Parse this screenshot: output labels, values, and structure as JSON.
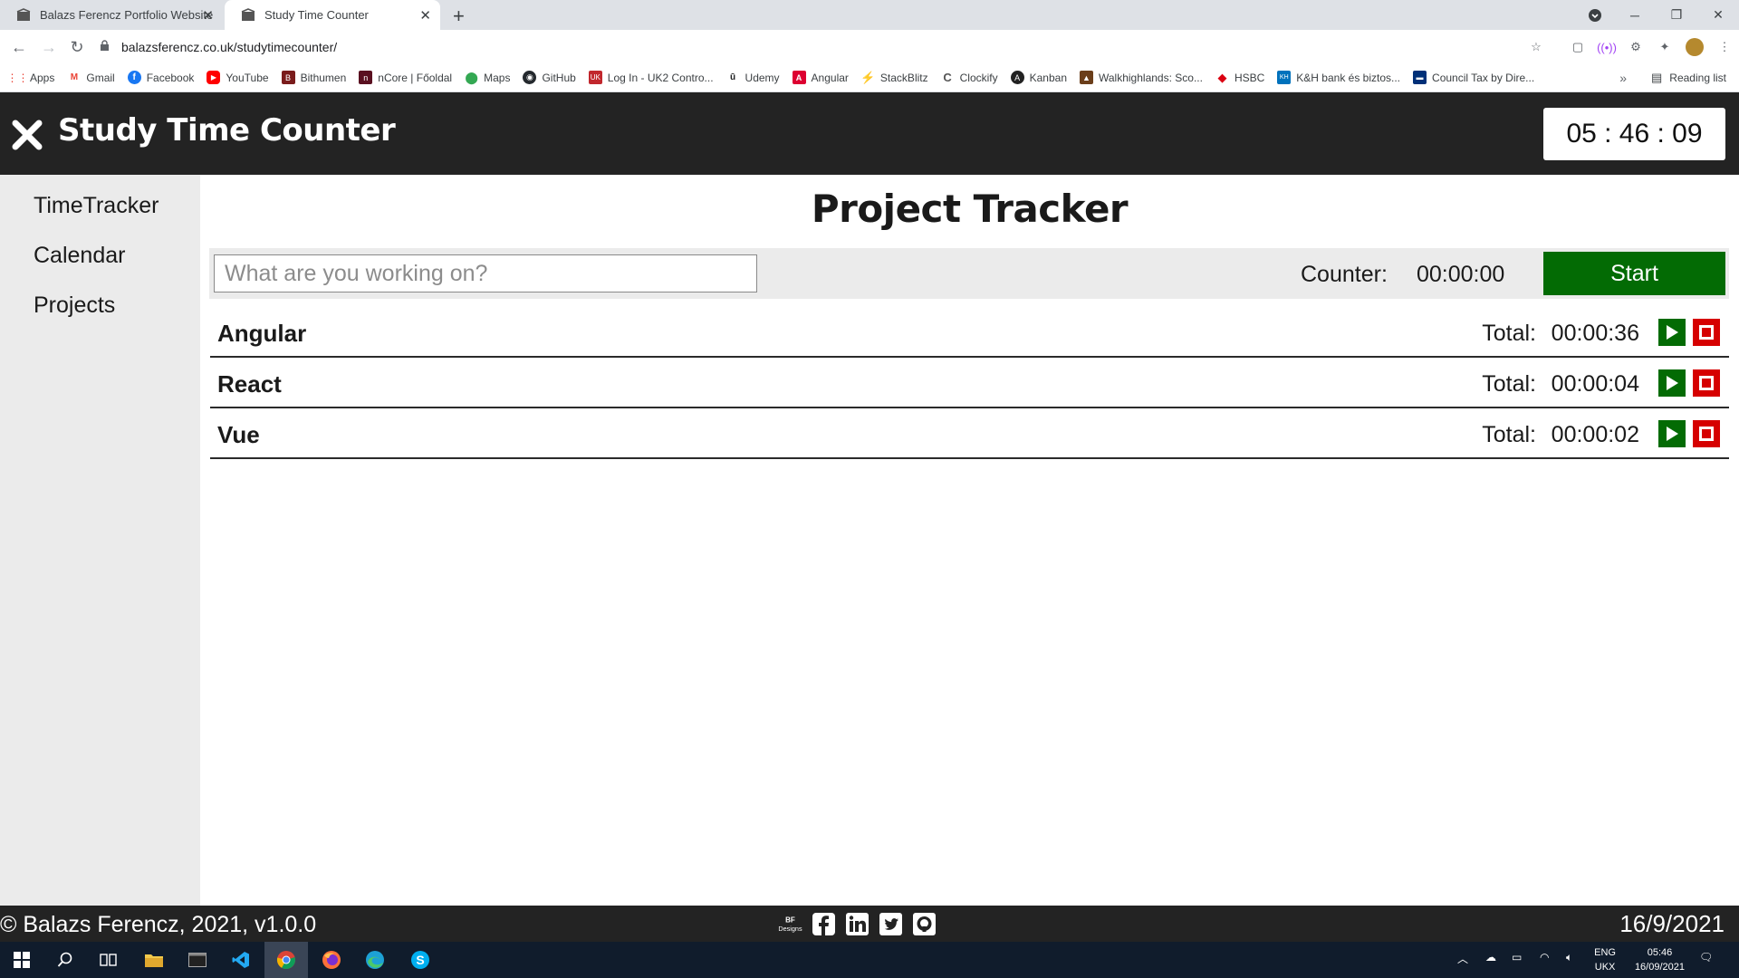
{
  "browser": {
    "tabs": [
      {
        "title": "Balazs Ferencz Portfolio Website"
      },
      {
        "title": "Study Time Counter"
      }
    ],
    "url": "balazsferencz.co.uk/studytimecounter/",
    "bookmarks": [
      {
        "label": "Apps",
        "icon": "apps-grid-icon",
        "color": "#ea4335"
      },
      {
        "label": "Gmail",
        "icon": "gmail-icon",
        "color": "#ea4335"
      },
      {
        "label": "Facebook",
        "icon": "facebook-icon",
        "color": "#1877f2"
      },
      {
        "label": "YouTube",
        "icon": "youtube-icon",
        "color": "#ff0000"
      },
      {
        "label": "Bithumen",
        "icon": "bithumen-icon",
        "color": "#7a1c1c"
      },
      {
        "label": "nCore | Főoldal",
        "icon": "ncore-icon",
        "color": "#5a1020"
      },
      {
        "label": "Maps",
        "icon": "maps-icon",
        "color": "#34a853"
      },
      {
        "label": "GitHub",
        "icon": "github-icon",
        "color": "#24292e"
      },
      {
        "label": "Log In - UK2 Contro...",
        "icon": "uk2-icon",
        "color": "#c1272d"
      },
      {
        "label": "Udemy",
        "icon": "udemy-icon",
        "color": "#1c1d1f"
      },
      {
        "label": "Angular",
        "icon": "angular-icon",
        "color": "#dd0031"
      },
      {
        "label": "StackBlitz",
        "icon": "stackblitz-icon",
        "color": "#1389fd"
      },
      {
        "label": "Clockify",
        "icon": "clockify-icon",
        "color": "#03a9f4"
      },
      {
        "label": "Kanban",
        "icon": "kanban-icon",
        "color": "#222222"
      },
      {
        "label": "Walkhighlands: Sco...",
        "icon": "walkhighlands-icon",
        "color": "#6b3e1a"
      },
      {
        "label": "HSBC",
        "icon": "hsbc-icon",
        "color": "#db0011"
      },
      {
        "label": "K&H bank és biztos...",
        "icon": "kh-icon",
        "color": "#0072bc"
      },
      {
        "label": "Council Tax by Dire...",
        "icon": "council-icon",
        "color": "#003078"
      }
    ],
    "reading_list": "Reading list"
  },
  "app": {
    "title": "Study Time Counter",
    "clock": "05 : 46 : 09",
    "sidebar": [
      {
        "label": "TimeTracker"
      },
      {
        "label": "Calendar"
      },
      {
        "label": "Projects"
      }
    ],
    "page_title": "Project Tracker",
    "entry": {
      "placeholder": "What are you working on?",
      "value": "",
      "counter_label": "Counter:",
      "counter_value": "00:00:00",
      "start_label": "Start"
    },
    "projects": [
      {
        "name": "Angular",
        "total_label": "Total:",
        "total": "00:00:36"
      },
      {
        "name": "React",
        "total_label": "Total:",
        "total": "00:00:04"
      },
      {
        "name": "Vue",
        "total_label": "Total:",
        "total": "00:00:02"
      }
    ],
    "footer": {
      "copyright": "© Balazs Ferencz, 2021, v1.0.0",
      "logo_text": "BF Designs",
      "date": "16/9/2021"
    },
    "colors": {
      "header_bg": "#232323",
      "sidebar_bg": "#ebebeb",
      "start_green": "#036b04",
      "stop_red": "#d60000"
    }
  },
  "taskbar": {
    "lang_line1": "ENG",
    "lang_line2": "UKX",
    "time": "05:46",
    "date": "16/09/2021"
  }
}
